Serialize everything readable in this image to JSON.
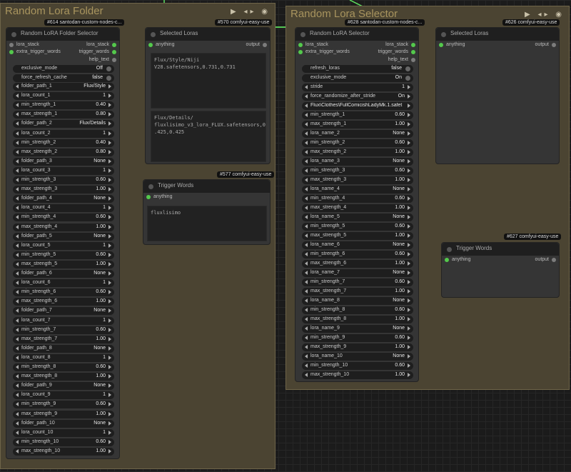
{
  "groups": {
    "left": {
      "title": "Random Lora Folder"
    },
    "right": {
      "title": "Random Lora Selector"
    }
  },
  "left_folder_node": {
    "badge": "#614 santodan-custom-nodes-c...",
    "title": "Random LoRA Folder Selector",
    "inputs": [
      "lora_stack",
      "extra_trigger_words"
    ],
    "outputs": [
      "lora_stack",
      "trigger_words",
      "help_text"
    ],
    "toggles": [
      {
        "label": "exclusive_mode",
        "value": "Off"
      },
      {
        "label": "force_refresh_cache",
        "value": "false"
      }
    ],
    "widgets": [
      {
        "label": "folder_path_1",
        "value": "Flux/Style"
      },
      {
        "label": "lora_count_1",
        "value": "1"
      },
      {
        "label": "min_strength_1",
        "value": "0.40"
      },
      {
        "label": "max_strength_1",
        "value": "0.80"
      },
      {
        "label": "folder_path_2",
        "value": "Flux/Details"
      },
      {
        "label": "lora_count_2",
        "value": "1"
      },
      {
        "label": "min_strength_2",
        "value": "0.40"
      },
      {
        "label": "max_strength_2",
        "value": "0.80"
      },
      {
        "label": "folder_path_3",
        "value": "None"
      },
      {
        "label": "lora_count_3",
        "value": "1"
      },
      {
        "label": "min_strength_3",
        "value": "0.60"
      },
      {
        "label": "max_strength_3",
        "value": "1.00"
      },
      {
        "label": "folder_path_4",
        "value": "None"
      },
      {
        "label": "lora_count_4",
        "value": "1"
      },
      {
        "label": "min_strength_4",
        "value": "0.60"
      },
      {
        "label": "max_strength_4",
        "value": "1.00"
      },
      {
        "label": "folder_path_5",
        "value": "None"
      },
      {
        "label": "lora_count_5",
        "value": "1"
      },
      {
        "label": "min_strength_5",
        "value": "0.60"
      },
      {
        "label": "max_strength_5",
        "value": "1.00"
      },
      {
        "label": "folder_path_6",
        "value": "None"
      },
      {
        "label": "lora_count_6",
        "value": "1"
      },
      {
        "label": "min_strength_6",
        "value": "0.60"
      },
      {
        "label": "max_strength_6",
        "value": "1.00"
      },
      {
        "label": "folder_path_7",
        "value": "None"
      },
      {
        "label": "lora_count_7",
        "value": "1"
      },
      {
        "label": "min_strength_7",
        "value": "0.60"
      },
      {
        "label": "max_strength_7",
        "value": "1.00"
      },
      {
        "label": "folder_path_8",
        "value": "None"
      },
      {
        "label": "lora_count_8",
        "value": "1"
      },
      {
        "label": "min_strength_8",
        "value": "0.60"
      },
      {
        "label": "max_strength_8",
        "value": "1.00"
      },
      {
        "label": "folder_path_9",
        "value": "None"
      },
      {
        "label": "lora_count_9",
        "value": "1"
      },
      {
        "label": "min_strength_9",
        "value": "0.60"
      },
      {
        "label": "max_strength_9",
        "value": "1.00"
      },
      {
        "label": "folder_path_10",
        "value": "None"
      },
      {
        "label": "lora_count_10",
        "value": "1"
      },
      {
        "label": "min_strength_10",
        "value": "0.60"
      },
      {
        "label": "max_strength_10",
        "value": "1.00"
      }
    ]
  },
  "left_selected_node": {
    "badge": "#570 comfyui-easy-use",
    "title": "Selected Loras",
    "input": "anything",
    "output": "output",
    "text1": "Flux/Style/Niji\nV28.safetensors,0.731,0.731",
    "text2": "Flux/Details/\nfluxlisimo_v3_lora_FLUX.safetensors,0\n.425,0.425"
  },
  "left_trigger_node": {
    "badge": "#577 comfyui-easy-use",
    "title": "Trigger Words",
    "input": "anything",
    "text": "fluxlisimo"
  },
  "right_selector_node": {
    "badge": "#628 santodan-custom-nodes-c...",
    "title": "Random LoRA Selector",
    "inputs": [
      "lora_stack",
      "extra_trigger_words"
    ],
    "outputs": [
      "lora_stack",
      "trigger_words",
      "help_text"
    ],
    "toggles": [
      {
        "label": "refresh_loras",
        "value": "false"
      },
      {
        "label": "exclusive_mode",
        "value": "On"
      }
    ],
    "stride": {
      "label": "stride",
      "value": "1"
    },
    "force": {
      "label": "force_randomize_after_stride",
      "value": "On"
    },
    "lora_name_1": "Flux\\Clothes\\FullComicishLadyMk.1.safet",
    "widgets": [
      {
        "label": "min_strength_1",
        "value": "0.60"
      },
      {
        "label": "max_strength_1",
        "value": "1.00"
      },
      {
        "label": "lora_name_2",
        "value": "None"
      },
      {
        "label": "min_strength_2",
        "value": "0.60"
      },
      {
        "label": "max_strength_2",
        "value": "1.00"
      },
      {
        "label": "lora_name_3",
        "value": "None"
      },
      {
        "label": "min_strength_3",
        "value": "0.60"
      },
      {
        "label": "max_strength_3",
        "value": "1.00"
      },
      {
        "label": "lora_name_4",
        "value": "None"
      },
      {
        "label": "min_strength_4",
        "value": "0.60"
      },
      {
        "label": "max_strength_4",
        "value": "1.00"
      },
      {
        "label": "lora_name_5",
        "value": "None"
      },
      {
        "label": "min_strength_5",
        "value": "0.60"
      },
      {
        "label": "max_strength_5",
        "value": "1.00"
      },
      {
        "label": "lora_name_6",
        "value": "None"
      },
      {
        "label": "min_strength_6",
        "value": "0.60"
      },
      {
        "label": "max_strength_6",
        "value": "1.00"
      },
      {
        "label": "lora_name_7",
        "value": "None"
      },
      {
        "label": "min_strength_7",
        "value": "0.60"
      },
      {
        "label": "max_strength_7",
        "value": "1.00"
      },
      {
        "label": "lora_name_8",
        "value": "None"
      },
      {
        "label": "min_strength_8",
        "value": "0.60"
      },
      {
        "label": "max_strength_8",
        "value": "1.00"
      },
      {
        "label": "lora_name_9",
        "value": "None"
      },
      {
        "label": "min_strength_9",
        "value": "0.60"
      },
      {
        "label": "max_strength_9",
        "value": "1.00"
      },
      {
        "label": "lora_name_10",
        "value": "None"
      },
      {
        "label": "min_strength_10",
        "value": "0.60"
      },
      {
        "label": "max_strength_10",
        "value": "1.00"
      }
    ]
  },
  "right_selected_node": {
    "badge": "#626 comfyui-easy-use",
    "title": "Selected Loras",
    "input": "anything",
    "output": "output"
  },
  "right_trigger_node": {
    "badge": "#627 comfyui-easy-use",
    "title": "Trigger Words",
    "input": "anything",
    "output": "output"
  },
  "colors": {
    "wire": "#5fe05f",
    "group": "#4b4432",
    "node": "#353535"
  }
}
